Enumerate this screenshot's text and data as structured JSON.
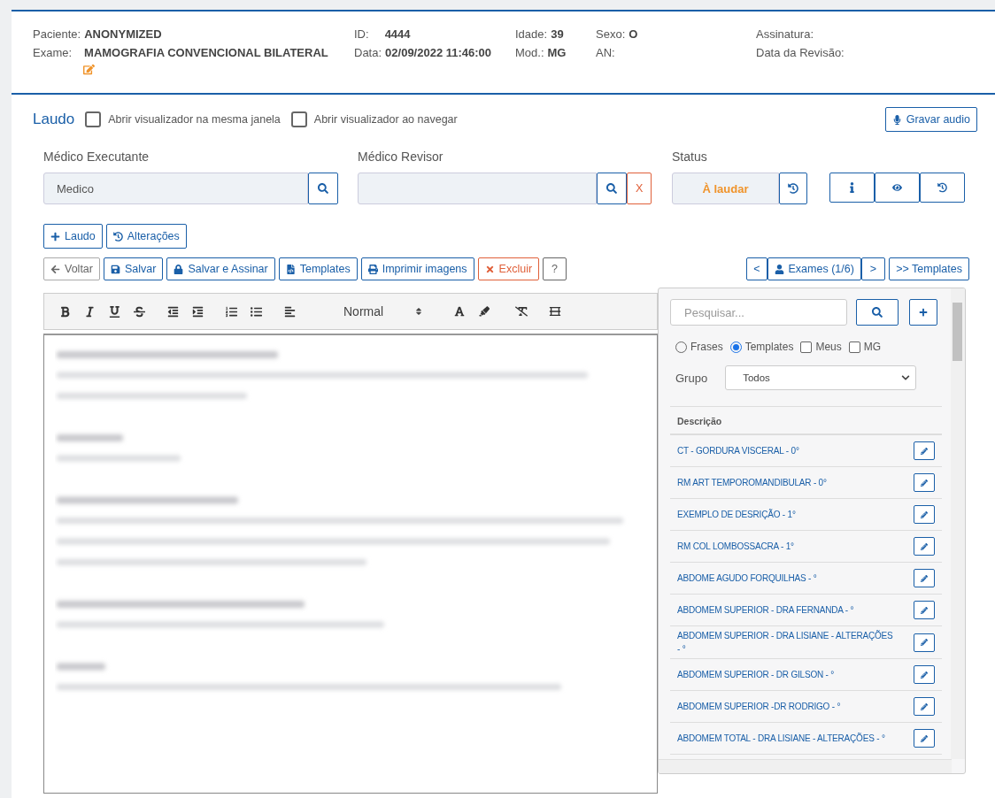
{
  "header": {
    "columns": [
      {
        "fields": [
          {
            "label": "Paciente:",
            "value": "ANONYMIZED"
          },
          {
            "label": "Exame:",
            "value": "MAMOGRAFIA CONVENCIONAL BILATERAL",
            "editable": true
          }
        ]
      },
      {
        "fields": [
          {
            "label": "ID:",
            "value": "4444"
          },
          {
            "label": "Data:",
            "value": "02/09/2022 11:46:00"
          }
        ]
      },
      {
        "fields": [
          {
            "label": "Idade:",
            "value": "39"
          },
          {
            "label": "Mod.:",
            "value": "MG"
          }
        ]
      },
      {
        "fields": [
          {
            "label": "Sexo:",
            "value": "O"
          },
          {
            "label": "AN:"
          }
        ]
      },
      {
        "fields": [
          {
            "label": "Assinatura:"
          },
          {
            "label": "Data da Revisão:"
          }
        ]
      }
    ]
  },
  "laudo": {
    "title": "Laudo",
    "options": [
      {
        "label": "Abrir visualizador na mesma janela",
        "checked": false
      },
      {
        "label": "Abrir visualizador ao navegar",
        "checked": false
      }
    ],
    "record_button": "Gravar audio"
  },
  "medico_executante": {
    "label": "Médico Executante",
    "value": "Medico"
  },
  "medico_revisor": {
    "label": "Médico Revisor",
    "clear": "X"
  },
  "status": {
    "label": "Status",
    "value": "À laudar"
  },
  "add_buttons": [
    {
      "label": "Laudo"
    },
    {
      "label": "Alterações"
    }
  ],
  "actions": [
    {
      "label": "Voltar",
      "kind": "default"
    },
    {
      "label": "Salvar",
      "kind": "primary"
    },
    {
      "label": "Salvar e Assinar",
      "kind": "primary"
    },
    {
      "label": "Templates",
      "kind": "primary"
    },
    {
      "label": "Imprimir imagens",
      "kind": "primary"
    },
    {
      "label": "Excluir",
      "kind": "danger"
    },
    {
      "label": "?",
      "kind": "default"
    }
  ],
  "nav": {
    "prev": "<",
    "exams": "Exames (1/6)",
    "next": ">",
    "templates": ">> Templates"
  },
  "editor": {
    "format": "Normal"
  },
  "panel": {
    "search_placeholder": "Pesquisar...",
    "filters": [
      {
        "label": "Frases",
        "kind": "radio",
        "selected": false
      },
      {
        "label": "Templates",
        "kind": "radio",
        "selected": true
      },
      {
        "label": "Meus",
        "kind": "checkbox",
        "checked": false
      },
      {
        "label": "MG",
        "kind": "checkbox",
        "checked": false
      }
    ],
    "group": {
      "label": "Grupo",
      "value": "Todos"
    },
    "column": "Descrição",
    "rows": [
      "CT - GORDURA VISCERAL - 0°",
      "RM ART TEMPOROMANDIBULAR - 0°",
      "EXEMPLO DE DESRIÇÃO - 1°",
      "RM COL LOMBOSSACRA - 1°",
      "ABDOME AGUDO FORQUILHAS - °",
      "ABDOMEM SUPERIOR - DRA FERNANDA - °",
      "ABDOMEM SUPERIOR - DRA LISIANE - ALTERAÇÕES - °",
      "ABDOMEM SUPERIOR - DR GILSON - °",
      "ABDOMEM SUPERIOR -DR RODRIGO - °",
      "ABDOMEM TOTAL - DRA LISIANE - ALTERAÇÕES - °"
    ]
  }
}
